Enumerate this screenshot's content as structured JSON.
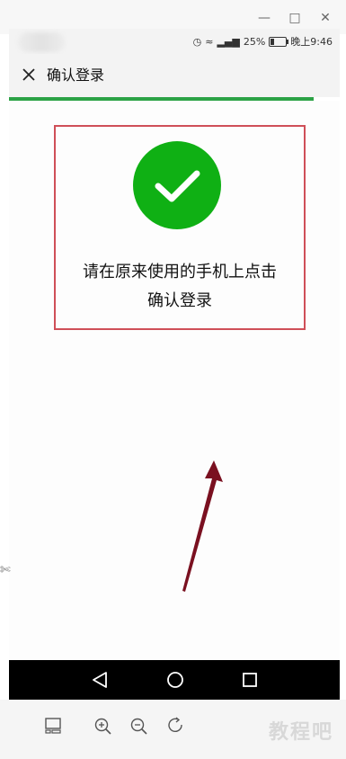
{
  "window": {
    "minimize_icon": "minimize-icon",
    "maximize_icon": "maximize-icon",
    "close_icon": "window-close-icon"
  },
  "status_bar": {
    "battery": "25%",
    "time": "晚上9:46",
    "battery_level": 0.25
  },
  "header": {
    "title": "确认登录",
    "close_icon": "close-icon"
  },
  "progress": {
    "fraction": 0.92,
    "color": "#2ba245"
  },
  "main": {
    "line1": "请在原来使用的手机上点击",
    "line2": "确认登录",
    "check_color": "#0fb014",
    "box_color": "#cf4f58"
  },
  "nav": {
    "back_icon": "back-icon",
    "home_icon": "home-icon",
    "recents_icon": "recents-icon"
  },
  "toolbar": {
    "watermark": "教程吧"
  }
}
